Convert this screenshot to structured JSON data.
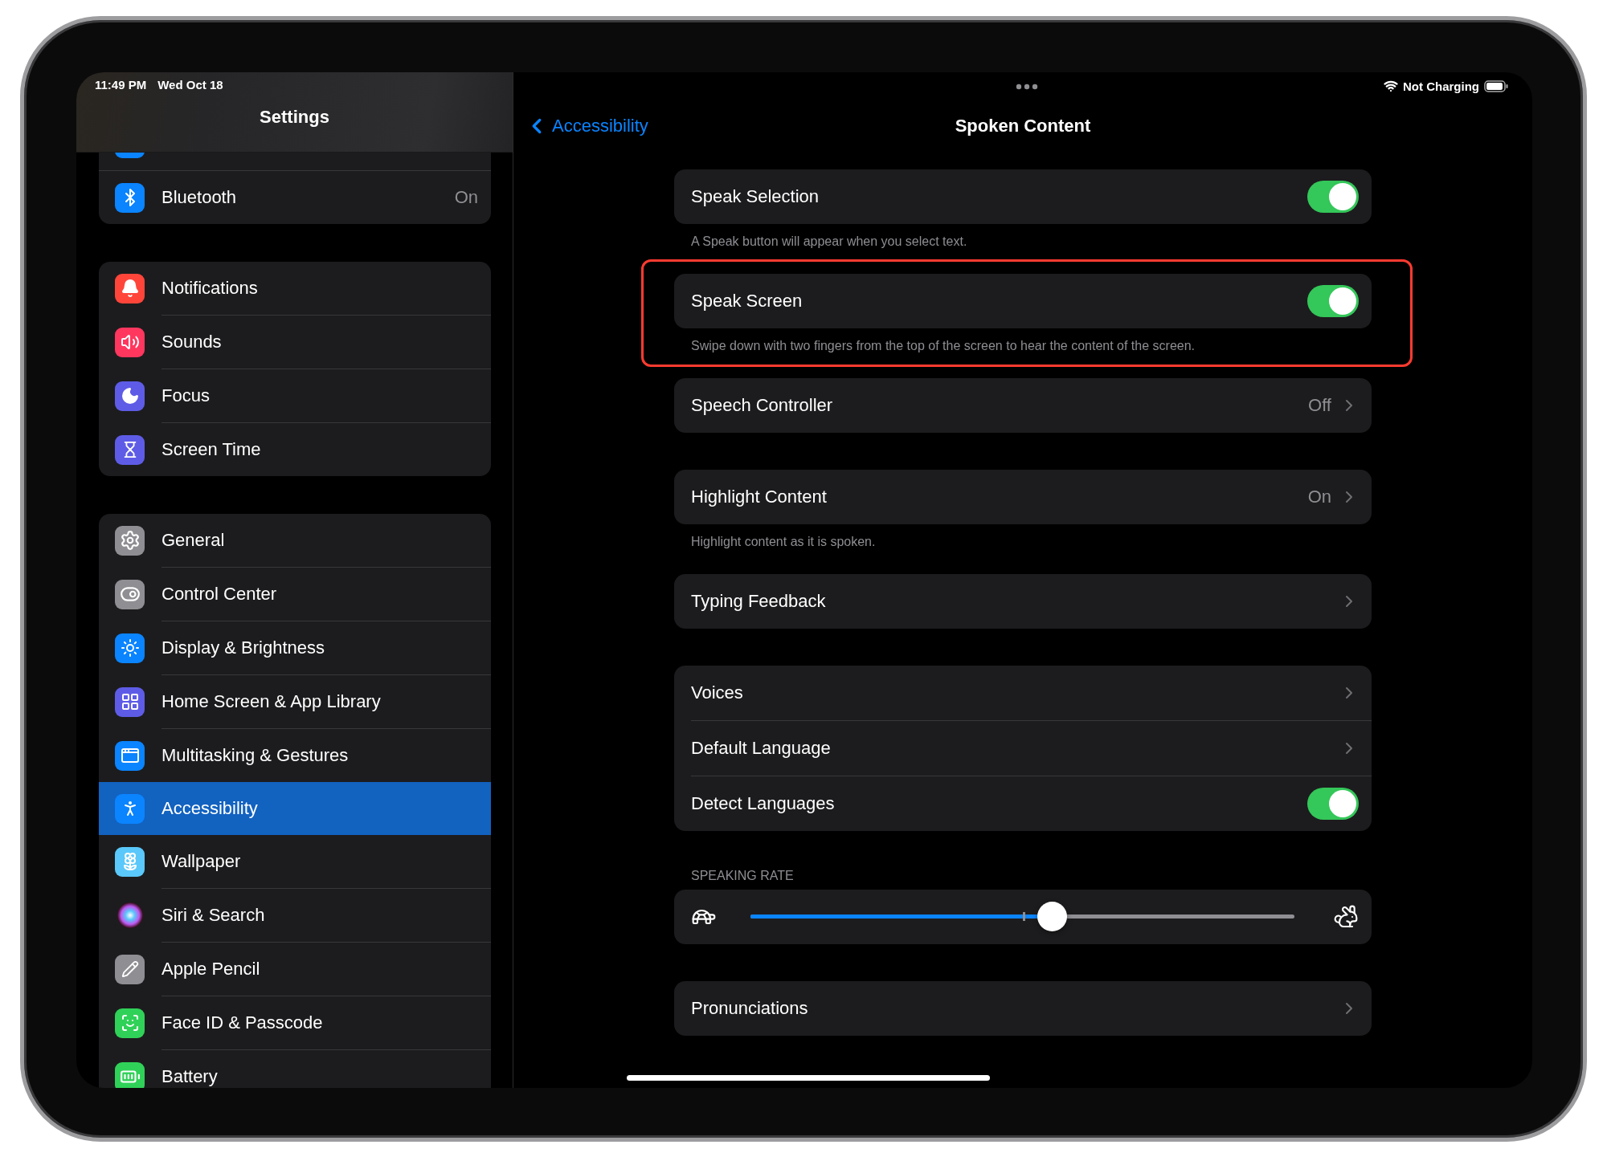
{
  "status_bar": {
    "time": "11:49 PM",
    "date": "Wed Oct 18",
    "power": "Not Charging"
  },
  "sidebar": {
    "title": "Settings",
    "groups": [
      {
        "items": [
          {
            "label": "Bluetooth",
            "value": "On",
            "selected": false
          }
        ]
      },
      {
        "items": [
          {
            "label": "Notifications",
            "selected": false
          },
          {
            "label": "Sounds",
            "selected": false
          },
          {
            "label": "Focus",
            "selected": false
          },
          {
            "label": "Screen Time",
            "selected": false
          }
        ]
      },
      {
        "items": [
          {
            "label": "General",
            "selected": false
          },
          {
            "label": "Control Center",
            "selected": false
          },
          {
            "label": "Display & Brightness",
            "selected": false
          },
          {
            "label": "Home Screen & App Library",
            "selected": false
          },
          {
            "label": "Multitasking & Gestures",
            "selected": false
          },
          {
            "label": "Accessibility",
            "selected": true
          },
          {
            "label": "Wallpaper",
            "selected": false
          },
          {
            "label": "Siri & Search",
            "selected": false
          },
          {
            "label": "Apple Pencil",
            "selected": false
          },
          {
            "label": "Face ID & Passcode",
            "selected": false
          },
          {
            "label": "Battery",
            "selected": false
          }
        ]
      }
    ]
  },
  "detail": {
    "back": "Accessibility",
    "title": "Spoken Content",
    "groups": [
      {
        "highlighted": false,
        "rows": [
          {
            "kind": "toggle",
            "label": "Speak Selection",
            "on": true
          }
        ],
        "footer": "A Speak button will appear when you select text."
      },
      {
        "highlighted": true,
        "rows": [
          {
            "kind": "toggle",
            "label": "Speak Screen",
            "on": true
          }
        ],
        "footer": "Swipe down with two fingers from the top of the screen to hear the content of the screen."
      },
      {
        "highlighted": false,
        "rows": [
          {
            "kind": "link",
            "label": "Speech Controller",
            "value": "Off"
          }
        ]
      },
      {
        "highlighted": false,
        "rows": [
          {
            "kind": "link",
            "label": "Highlight Content",
            "value": "On"
          }
        ],
        "footer": "Highlight content as it is spoken."
      },
      {
        "highlighted": false,
        "rows": [
          {
            "kind": "link",
            "label": "Typing Feedback"
          }
        ]
      },
      {
        "highlighted": false,
        "rows": [
          {
            "kind": "link",
            "label": "Voices"
          },
          {
            "kind": "link",
            "label": "Default Language"
          },
          {
            "kind": "toggle",
            "label": "Detect Languages",
            "on": true
          }
        ]
      },
      {
        "highlighted": false,
        "header": "SPEAKING RATE",
        "rows": [
          {
            "kind": "slider",
            "level": 0.554
          }
        ]
      },
      {
        "highlighted": false,
        "rows": [
          {
            "kind": "link",
            "label": "Pronunciations"
          }
        ]
      }
    ]
  }
}
